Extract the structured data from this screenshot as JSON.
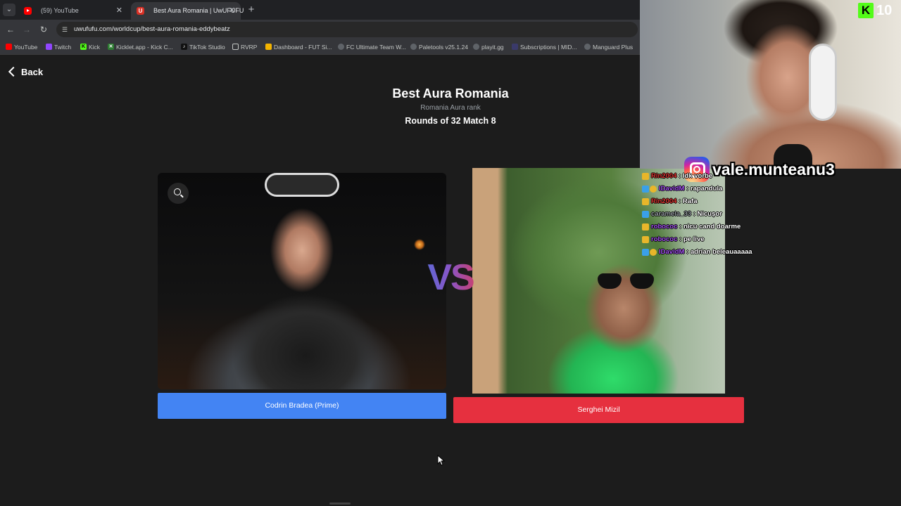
{
  "browser": {
    "tabs": [
      {
        "label": "(59) YouTube",
        "active": false
      },
      {
        "label": "Best Aura Romania | UwUFUFU",
        "active": true
      }
    ],
    "url": "uwufufu.com/worldcup/best-aura-romania-eddybeatz",
    "bookmarks": [
      {
        "label": "YouTube",
        "color": "#ff0000"
      },
      {
        "label": "Twitch",
        "color": "#9146ff"
      },
      {
        "label": "Kick",
        "color": "#53fc18"
      },
      {
        "label": "Kicklet.app - Kick C...",
        "color": "#2e7d32"
      },
      {
        "label": "TikTok Studio",
        "color": "#111111"
      },
      {
        "label": "RVRP",
        "color": "#777777"
      },
      {
        "label": "Dashboard - FUT Si...",
        "color": "#f4b400"
      },
      {
        "label": "FC Ultimate Team W...",
        "color": "#777777"
      },
      {
        "label": "Paletools v25.1.24",
        "color": "#777777"
      },
      {
        "label": "playit.gg",
        "color": "#777777"
      },
      {
        "label": "Subscriptions | MID...",
        "color": "#3a3a6a"
      },
      {
        "label": "Manguard Plus",
        "color": "#777777"
      }
    ]
  },
  "page": {
    "back_label": "Back",
    "title": "Best Aura Romania",
    "subtitle": "Romania Aura rank",
    "round": "Rounds of 32 Match 8",
    "vs": "VS",
    "left_choice": "Codrin Bradea (Prime)",
    "right_choice": "Serghei Mizil"
  },
  "overlay": {
    "kick_viewers": "10",
    "instagram": "vale.munteanu3",
    "chat": [
      {
        "user": "Rin2004",
        "text": "Idk vorbe",
        "user_color": "#e53935",
        "badge": "#e8b62a"
      },
      {
        "user": "IDavidM",
        "text": "rapandula",
        "user_color": "#a855f7",
        "badge": "#3aa0e8"
      },
      {
        "user": "Rin2004",
        "text": "Rafa",
        "user_color": "#e53935",
        "badge": "#e8b62a"
      },
      {
        "user": "caramela_33",
        "text": "Nicușor",
        "user_color": "#9aa0a6",
        "badge": "#3aa0e8"
      },
      {
        "user": "robococ",
        "text": "nicu cand doarme",
        "user_color": "#a855f7",
        "badge": "#e8b62a"
      },
      {
        "user": "robococ",
        "text": "pe live",
        "user_color": "#a855f7",
        "badge": "#e8b62a"
      },
      {
        "user": "IDavidM",
        "text": "adrian beleauaaaaa",
        "user_color": "#a855f7",
        "badge": "#3aa0e8"
      }
    ]
  }
}
